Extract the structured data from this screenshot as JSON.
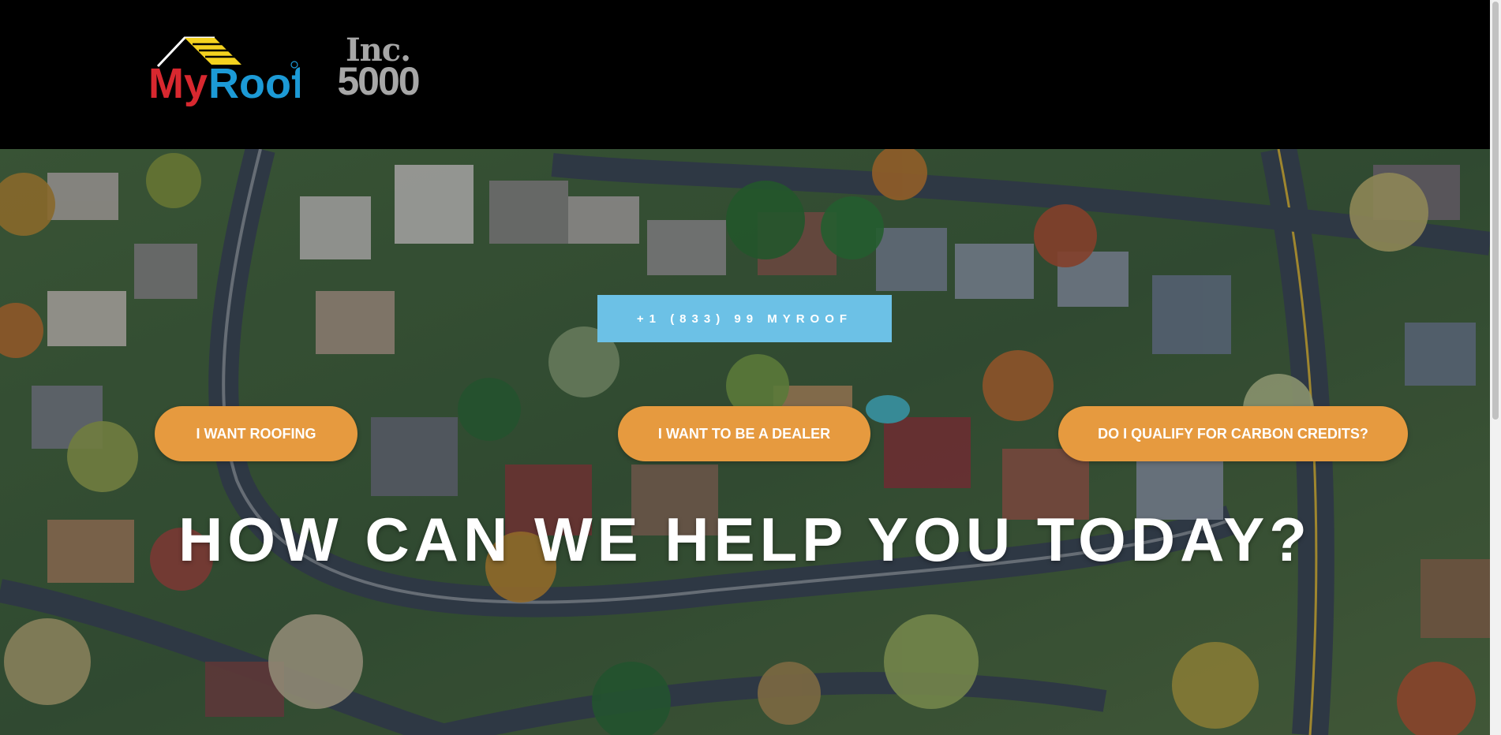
{
  "header": {
    "logo_text": "MyRoof",
    "inc_word": "Inc.",
    "inc_number": "5000"
  },
  "hero": {
    "phone_label": "+1 (833) 99 MYROOF",
    "buttons": [
      {
        "label": "I WANT ROOFING"
      },
      {
        "label": "I WANT TO BE A DEALER"
      },
      {
        "label": "DO I QUALIFY FOR CARBON CREDITS?"
      }
    ],
    "headline": "HOW CAN WE HELP YOU TODAY?"
  },
  "colors": {
    "phone_button": "#6cc1e6",
    "pill_button": "#e69a3f",
    "logo_red": "#d8282f",
    "logo_blue": "#1c9ad6",
    "logo_yellow": "#f4d21f"
  }
}
